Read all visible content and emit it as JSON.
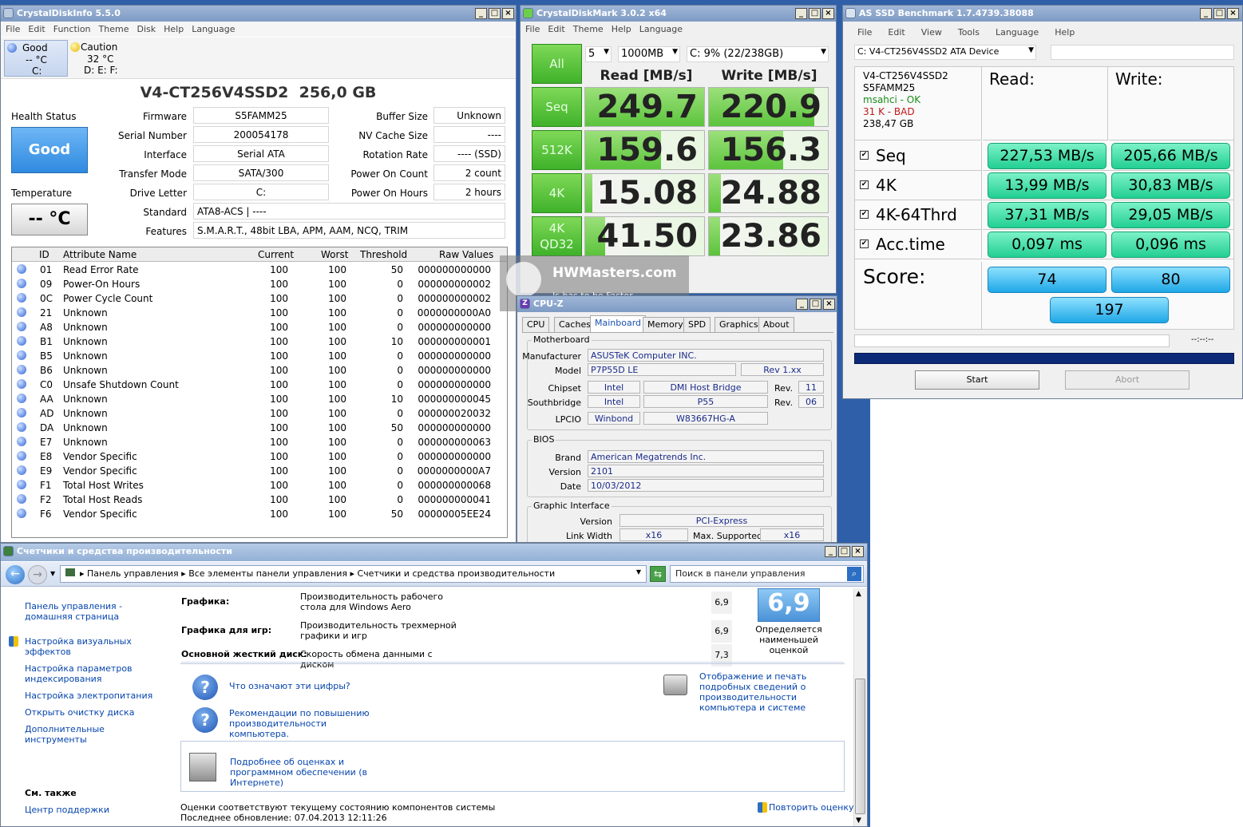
{
  "cdi": {
    "title": "CrystalDiskInfo 5.5.0",
    "menu": [
      "File",
      "Edit",
      "Function",
      "Theme",
      "Disk",
      "Help",
      "Language"
    ],
    "status_good": "Good",
    "status_good_temp": "-- °C",
    "status_good_drive": "C:",
    "status_caution": "Caution",
    "status_caution_temp": "32 °C",
    "status_caution_drives": "D: E: F:",
    "disk_title": "V4-CT256V4SSD2  256,0 GB",
    "health_label": "Health Status",
    "health_value": "Good",
    "temp_label": "Temperature",
    "temp_value": "-- °C",
    "labels": {
      "firmware": "Firmware",
      "serial": "Serial Number",
      "interface": "Interface",
      "transfer": "Transfer Mode",
      "letter": "Drive Letter",
      "standard": "Standard",
      "features": "Features",
      "buffer": "Buffer Size",
      "nvcache": "NV Cache Size",
      "rotation": "Rotation Rate",
      "poc": "Power On Count",
      "poh": "Power On Hours"
    },
    "values": {
      "firmware": "S5FAMM25",
      "serial": "200054178",
      "interface": "Serial ATA",
      "transfer": "SATA/300",
      "letter": "C:",
      "standard": "ATA8-ACS | ----",
      "features": "S.M.A.R.T., 48bit LBA, APM, AAM, NCQ, TRIM",
      "buffer": "Unknown",
      "nvcache": "----",
      "rotation": "---- (SSD)",
      "poc": "2 count",
      "poh": "2 hours"
    },
    "columns": [
      "ID",
      "Attribute Name",
      "Current",
      "Worst",
      "Threshold",
      "Raw Values"
    ],
    "rows": [
      [
        "01",
        "Read Error Rate",
        "100",
        "100",
        "50",
        "000000000000"
      ],
      [
        "09",
        "Power-On Hours",
        "100",
        "100",
        "0",
        "000000000002"
      ],
      [
        "0C",
        "Power Cycle Count",
        "100",
        "100",
        "0",
        "000000000002"
      ],
      [
        "21",
        "Unknown",
        "100",
        "100",
        "0",
        "0000000000A0"
      ],
      [
        "A8",
        "Unknown",
        "100",
        "100",
        "0",
        "000000000000"
      ],
      [
        "B1",
        "Unknown",
        "100",
        "100",
        "10",
        "000000000001"
      ],
      [
        "B5",
        "Unknown",
        "100",
        "100",
        "0",
        "000000000000"
      ],
      [
        "B6",
        "Unknown",
        "100",
        "100",
        "0",
        "000000000000"
      ],
      [
        "C0",
        "Unsafe Shutdown Count",
        "100",
        "100",
        "0",
        "000000000000"
      ],
      [
        "AA",
        "Unknown",
        "100",
        "100",
        "10",
        "000000000045"
      ],
      [
        "AD",
        "Unknown",
        "100",
        "100",
        "0",
        "000000020032"
      ],
      [
        "DA",
        "Unknown",
        "100",
        "100",
        "50",
        "000000000000"
      ],
      [
        "E7",
        "Unknown",
        "100",
        "100",
        "0",
        "000000000063"
      ],
      [
        "E8",
        "Vendor Specific",
        "100",
        "100",
        "0",
        "000000000000"
      ],
      [
        "E9",
        "Vendor Specific",
        "100",
        "100",
        "0",
        "0000000000A7"
      ],
      [
        "F1",
        "Total Host Writes",
        "100",
        "100",
        "0",
        "000000000068"
      ],
      [
        "F2",
        "Total Host Reads",
        "100",
        "100",
        "0",
        "000000000041"
      ],
      [
        "F6",
        "Vendor Specific",
        "100",
        "100",
        "50",
        "00000005EE24"
      ]
    ]
  },
  "cdm": {
    "title": "CrystalDiskMark 3.0.2 x64",
    "menu": [
      "File",
      "Edit",
      "Theme",
      "Help",
      "Language"
    ],
    "all_label": "All",
    "runs": "5",
    "size": "1000MB",
    "drive": "C: 9% (22/238GB)",
    "read_header": "Read [MB/s]",
    "write_header": "Write [MB/s]",
    "tests": [
      {
        "label": "Seq",
        "read": "249.7",
        "write": "220.9"
      },
      {
        "label": "512K",
        "read": "159.6",
        "write": "156.3"
      },
      {
        "label": "4K",
        "read": "15.08",
        "write": "24.88"
      },
      {
        "label": "4K\nQD32",
        "read": "41.50",
        "write": "23.86"
      }
    ]
  },
  "asssd": {
    "title": "AS SSD Benchmark 1.7.4739.38088",
    "menu": [
      "File",
      "Edit",
      "View",
      "Tools",
      "Language",
      "Help"
    ],
    "device": "C: V4-CT256V4SSD2 ATA Device",
    "info_model": "V4-CT256V4SSD2",
    "info_fw": "S5FAMM25",
    "info_msahci": "msahci - OK",
    "info_align": "31 K - BAD",
    "info_size": "238,47 GB",
    "read_header": "Read:",
    "write_header": "Write:",
    "tests": [
      {
        "label": "Seq",
        "read": "227,53 MB/s",
        "write": "205,66 MB/s"
      },
      {
        "label": "4K",
        "read": "13,99 MB/s",
        "write": "30,83 MB/s"
      },
      {
        "label": "4K-64Thrd",
        "read": "37,31 MB/s",
        "write": "29,05 MB/s"
      },
      {
        "label": "Acc.time",
        "read": "0,097 ms",
        "write": "0,096 ms"
      }
    ],
    "score_label": "Score:",
    "score_read": "74",
    "score_write": "80",
    "score_total": "197",
    "timer": "--:--:--",
    "start": "Start",
    "abort": "Abort"
  },
  "watermark": {
    "site": "HWMasters.com",
    "tagline": "Is has to be Faster"
  },
  "cpuz": {
    "title": "CPU-Z",
    "tabs": [
      "CPU",
      "Caches",
      "Mainboard",
      "Memory",
      "SPD",
      "Graphics",
      "About"
    ],
    "mb_group": "Motherboard",
    "manufacturer_label": "Manufacturer",
    "manufacturer": "ASUSTeK Computer INC.",
    "model_label": "Model",
    "model": "P7P55D LE",
    "model_rev": "Rev 1.xx",
    "chipset_label": "Chipset",
    "chipset_vendor": "Intel",
    "chipset_name": "DMI Host Bridge",
    "rev_label": "Rev.",
    "chipset_rev": "11",
    "south_label": "Southbridge",
    "south_vendor": "Intel",
    "south_name": "P55",
    "south_rev": "06",
    "lpcio_label": "LPCIO",
    "lpcio_vendor": "Winbond",
    "lpcio_name": "W83667HG-A",
    "bios_group": "BIOS",
    "brand_label": "Brand",
    "brand": "American Megatrends Inc.",
    "version_label": "Version",
    "version": "2101",
    "date_label": "Date",
    "date": "10/03/2012",
    "gi_group": "Graphic Interface",
    "gi_version_label": "Version",
    "gi_version": "PCI-Express",
    "gi_width_label": "Link Width",
    "gi_width": "x16",
    "gi_max_label": "Max. Supported",
    "gi_max": "x16"
  },
  "perf": {
    "title": "Счетчики и средства производительности",
    "breadcrumb": [
      "Панель управления",
      "Все элементы панели управления",
      "Счетчики и средства производительности"
    ],
    "search_placeholder": "Поиск в панели управления",
    "side_links": [
      "Панель управления - домашняя страница",
      "Настройка визуальных эффектов",
      "Настройка параметров индексирования",
      "Настройка электропитания",
      "Открыть очистку диска",
      "Дополнительные инструменты"
    ],
    "see_also": "См. также",
    "support": "Центр поддержки",
    "rows": [
      {
        "component": "Графика:",
        "desc": "Производительность рабочего стола для Windows Aero",
        "score": "6,9"
      },
      {
        "component": "Графика для игр:",
        "desc": "Производительность трехмерной графики и игр",
        "score": "6,9"
      },
      {
        "component": "Основной жесткий диск:",
        "desc": "Скорость обмена данными с диском",
        "score": "7,3"
      }
    ],
    "base_score": "6,9",
    "base_caption": "Определяется наименьшей оценкой",
    "help1": "Что означают эти цифры?",
    "help2": "Рекомендации по повышению производительности компьютера.",
    "print_link": "Отображение и печать подробных сведений о производительности компьютера и системе",
    "online_link": "Подробнее об оценках и программном обеспечении (в Интернете)",
    "status": "Оценки соответствуют текущему состоянию компонентов системы",
    "updated": "Последнее обновление: 07.04.2013 12:11:26",
    "rerun": "Повторить оценку"
  },
  "colors": {
    "cdm_green": "#5cc43c",
    "asssd_green": "#22cf92",
    "asssd_blue": "#1fa7e6",
    "cdi_blue": "#2f8ae0"
  }
}
